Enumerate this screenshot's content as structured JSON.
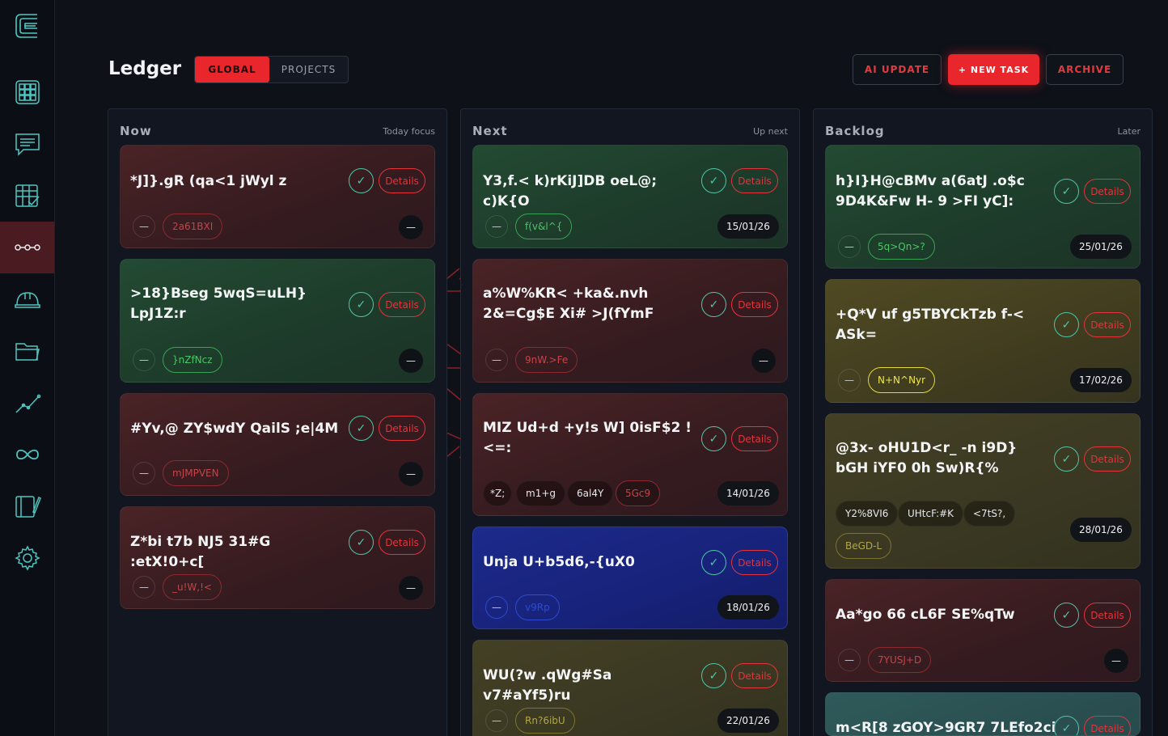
{
  "header": {
    "title": "Ledger",
    "scope_tabs": [
      "GLOBAL",
      "PROJECTS"
    ],
    "active_scope": "GLOBAL",
    "buttons": {
      "ai_update": "AI UPDATE",
      "new_task": "+ NEW TASK",
      "archive": "ARCHIVE"
    }
  },
  "sidebar": {
    "items": [
      "grid-icon",
      "chat-icon",
      "table-check-icon",
      "pipeline-icon",
      "helmet-icon",
      "folder-icon",
      "trend-icon",
      "infinity-icon",
      "notebook-icon",
      "gear-icon"
    ],
    "active": "pipeline-icon"
  },
  "colors": {
    "accent": "#e8262c",
    "check": "#4fc6a8"
  },
  "columns": [
    {
      "title": "Now",
      "subtitle": "Today focus",
      "cards": [
        {
          "title": "*J]}.gR (qa<1 jWyl z",
          "tags": [
            "2a61BXI"
          ],
          "details": "Details",
          "dash": "—",
          "right": "—"
        },
        {
          "title": ">18}Bseg 5wqS=uLH} LpJ1Z:r",
          "tags": [
            "}nZfNcz"
          ],
          "details": "Details",
          "dash": "—",
          "right": "—"
        },
        {
          "title": "#Yv,@ ZY$wdY QailS ;e|4M",
          "tags": [
            "mJMPVEN"
          ],
          "details": "Details",
          "dash": "—",
          "right": "—"
        },
        {
          "title": "Z*bi t7b NJ5 31#G :etX!0+c[",
          "tags": [
            "_u!W,!<"
          ],
          "details": "Details",
          "dash": "—",
          "right": "—"
        }
      ]
    },
    {
      "title": "Next",
      "subtitle": "Up next",
      "cards": [
        {
          "title": "Y3,f.< k)rKiJ]DB oeL@; c)K{O",
          "tags": [
            "f(v&l^{"
          ],
          "details": "Details",
          "dash": "—",
          "right": "15/01/26"
        },
        {
          "title": "a%W%KR< +ka&.nvh 2&=Cg$E Xi# >J(fYmF",
          "tags": [
            "9nW.>Fe"
          ],
          "details": "Details",
          "dash": "—",
          "right": "—"
        },
        {
          "title": "MIZ Ud+d +y!s W] 0isF$2 ! <=:",
          "tags": [
            "*Z;",
            "m1+g",
            "6al4Y",
            "5Gc9"
          ],
          "details": "Details",
          "right": "14/01/26"
        },
        {
          "title": "Unja U+b5d6,-{uX0",
          "tags": [
            "v9Rp"
          ],
          "details": "Details",
          "dash": "—",
          "right": "18/01/26"
        },
        {
          "title": "WU(?w .qWg#Sa v7#aYf5)ru",
          "tags": [
            "Rn?6ibU"
          ],
          "details": "Details",
          "dash": "—",
          "right": "22/01/26"
        }
      ]
    },
    {
      "title": "Backlog",
      "subtitle": "Later",
      "cards": [
        {
          "title": "h}I}H@cBMv a(6atJ .o$c 9D4K&Fw H- 9 >FI yC]:",
          "tags": [
            "5q>Qn>?"
          ],
          "details": "Details",
          "dash": "—",
          "right": "25/01/26"
        },
        {
          "title": "+Q*V uf g5TBYCkTzb f-< ASk=",
          "tags": [
            "N+N^Nyr"
          ],
          "details": "Details",
          "dash": "—",
          "right": "17/02/26"
        },
        {
          "title": "@3x- oHU1D<r_ -n i9D} bGH iYF0 0h Sw)R{%",
          "tags": [
            "Y2%8VI6",
            "UHtcF:#K",
            "<7tS?,",
            "BeGD-L"
          ],
          "details": "Details",
          "right": "28/01/26"
        },
        {
          "title": "Aa*go 66 cL6F SE%qTw",
          "tags": [
            "7YUSJ+D"
          ],
          "details": "Details",
          "dash": "—",
          "right": "—"
        },
        {
          "title": "m<R[8 zGOY>9GR7 7LEfo2ci",
          "tags": [],
          "details": "Details"
        }
      ]
    }
  ]
}
